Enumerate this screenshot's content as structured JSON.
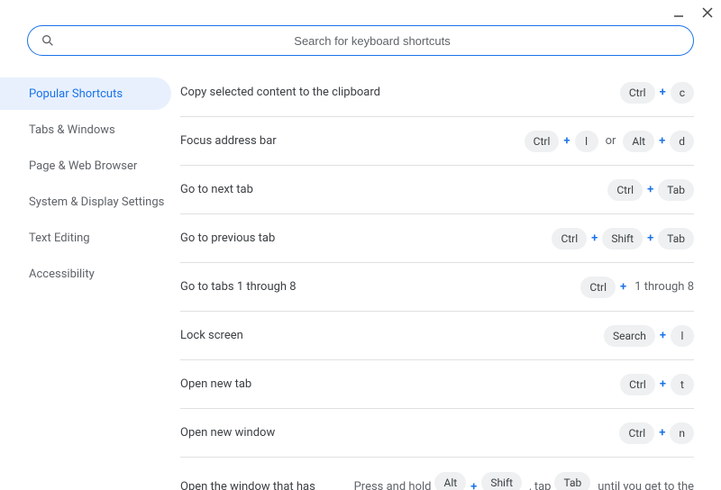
{
  "titlebar": {
    "minimize": "minimize",
    "close": "close"
  },
  "search": {
    "placeholder": "Search for keyboard shortcuts"
  },
  "sidebar": {
    "items": [
      {
        "label": "Popular Shortcuts",
        "active": true
      },
      {
        "label": "Tabs & Windows"
      },
      {
        "label": "Page & Web Browser"
      },
      {
        "label": "System & Display Settings"
      },
      {
        "label": "Text Editing"
      },
      {
        "label": "Accessibility"
      }
    ]
  },
  "separators": {
    "plus": "+",
    "or": "or"
  },
  "shortcuts": [
    {
      "desc": "Copy selected content to the clipboard",
      "keys": [
        {
          "k": "Ctrl"
        },
        {
          "sep": "+"
        },
        {
          "k": "c"
        }
      ]
    },
    {
      "desc": "Focus address bar",
      "keys": [
        {
          "k": "Ctrl"
        },
        {
          "sep": "+"
        },
        {
          "k": "l"
        },
        {
          "or": "or"
        },
        {
          "k": "Alt"
        },
        {
          "sep": "+"
        },
        {
          "k": "d"
        }
      ]
    },
    {
      "desc": "Go to next tab",
      "keys": [
        {
          "k": "Ctrl"
        },
        {
          "sep": "+"
        },
        {
          "k": "Tab"
        }
      ]
    },
    {
      "desc": "Go to previous tab",
      "keys": [
        {
          "k": "Ctrl"
        },
        {
          "sep": "+"
        },
        {
          "k": "Shift"
        },
        {
          "sep": "+"
        },
        {
          "k": "Tab"
        }
      ]
    },
    {
      "desc": "Go to tabs 1 through 8",
      "keys": [
        {
          "k": "Ctrl"
        },
        {
          "sep": "+"
        },
        {
          "plain": "1 through 8"
        }
      ]
    },
    {
      "desc": "Lock screen",
      "keys": [
        {
          "k": "Search"
        },
        {
          "sep": "+"
        },
        {
          "k": "l"
        }
      ]
    },
    {
      "desc": "Open new tab",
      "keys": [
        {
          "k": "Ctrl"
        },
        {
          "sep": "+"
        },
        {
          "k": "t"
        }
      ]
    },
    {
      "desc": "Open new window",
      "keys": [
        {
          "k": "Ctrl"
        },
        {
          "sep": "+"
        },
        {
          "k": "n"
        }
      ]
    }
  ],
  "partial": {
    "desc": "Open the window that has",
    "keys": [
      {
        "plain": "Press and hold"
      },
      {
        "k": "Alt"
      },
      {
        "sep": "+"
      },
      {
        "k": "Shift"
      },
      {
        "plain": ", tap"
      },
      {
        "k": "Tab"
      },
      {
        "plain": "until you get to the"
      }
    ]
  }
}
